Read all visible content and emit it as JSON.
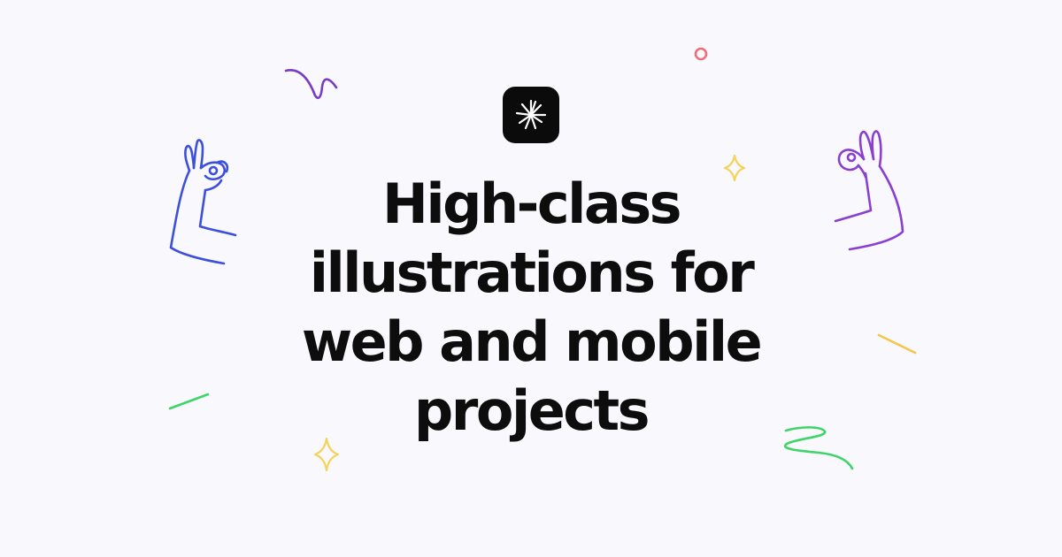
{
  "logo": {
    "icon": "starburst-icon",
    "background": "#0b0b0b",
    "foreground": "#ffffff"
  },
  "headline": {
    "lines": [
      "High-class",
      "illustrations for",
      "web and mobile",
      "projects"
    ]
  },
  "colors": {
    "background": "#f8f8fd",
    "text": "#0d0d0d",
    "blue_hand": "#3d4fdb",
    "purple_hand": "#8a3fd0",
    "purple_squiggle": "#7a3bc6",
    "red_ring": "#ee6e78",
    "yellow_sparkle": "#f5d25a",
    "orange_stroke": "#f4c64a",
    "green_stroke": "#3ed46a"
  },
  "decorations": [
    "ok-hand-left-icon",
    "ok-hand-right-icon",
    "squiggle-icon",
    "ring-icon",
    "sparkle-icon",
    "dash-icon",
    "zigzag-icon"
  ]
}
